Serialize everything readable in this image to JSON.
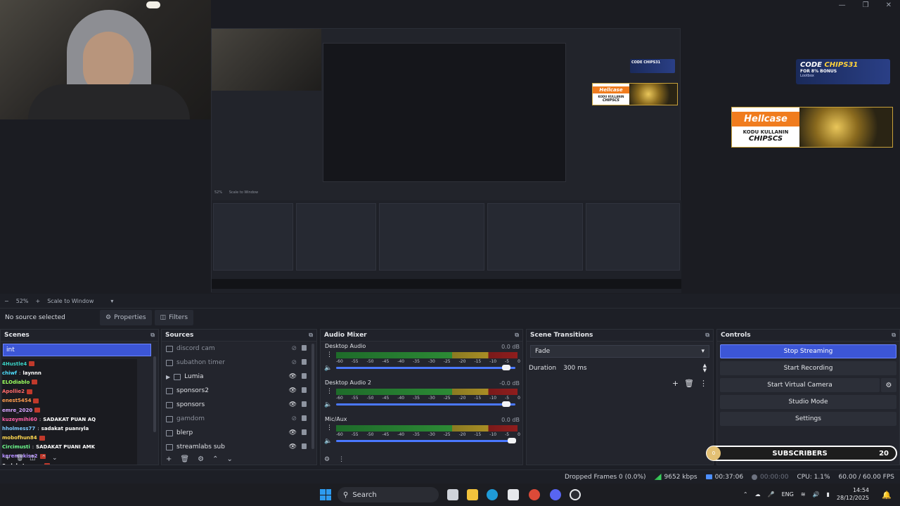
{
  "preview": {
    "nested_scene_label": "Scale to Window",
    "nested_zoom": "52%",
    "mid_badge": {
      "logo": "Hellcase",
      "line1": "KODU KULLANIN",
      "line2": "CHIPSCS"
    },
    "small_promo": "CODE CHIPS31"
  },
  "badge": {
    "logo": "Hellcase",
    "line1": "KODU KULLANIN",
    "line2": "CHIPSCS"
  },
  "promo": {
    "code_prefix": "CODE ",
    "code": "CHIPS31",
    "bonus": "FOR 8% BONUS",
    "brand": "Lootbox"
  },
  "zoom": {
    "percent": "52%",
    "plus": "+",
    "minus": "−",
    "mode": "Scale to Window",
    "caret": "▾"
  },
  "selection": {
    "no_source": "No source selected",
    "properties": "Properties",
    "filters": "Filters"
  },
  "scenes": {
    "title": "Scenes",
    "selected": "int",
    "chat": [
      {
        "nick": "4Hustle4",
        "msg": "",
        "color": "#3ad1c4"
      },
      {
        "nick": "chiwf",
        "msg": "laynnn",
        "color": "#4fe0ff"
      },
      {
        "nick": "ELOdiablo",
        "msg": "",
        "color": "#9cff5f"
      },
      {
        "nick": "Apollie2",
        "msg": "",
        "color": "#ff6b6b"
      },
      {
        "nick": "enest5454",
        "msg": "",
        "color": "#ff9d4f"
      },
      {
        "nick": "emre_2020",
        "msg": "",
        "color": "#d6a4ff"
      },
      {
        "nick": "kuzeymihi60",
        "msg": "SADAKAT PUAN AQ",
        "color": "#ff5fa8"
      },
      {
        "nick": "hholmess77",
        "msg": "sadakat puanıyla",
        "color": "#7ec8ff"
      },
      {
        "nick": "mobofhun84",
        "msg": "",
        "color": "#ffd84f"
      },
      {
        "nick": "Circimusti",
        "msg": "SADAKAT PUANI AMK",
        "color": "#6fff8f"
      },
      {
        "nick": "keremukisa2",
        "msg": "",
        "color": "#b48dff"
      },
      {
        "nick": "Sadakat puanı",
        "msg": "",
        "color": "#ffffff"
      }
    ]
  },
  "sources": {
    "title": "Sources",
    "items": [
      {
        "label": "discord cam",
        "dim": true,
        "icon": "display-capture-icon",
        "visible": false,
        "expand": false
      },
      {
        "label": "subathon timer",
        "dim": true,
        "icon": "browser-source-icon",
        "visible": false,
        "expand": false
      },
      {
        "label": "Lumia",
        "dim": false,
        "icon": "folder-icon",
        "visible": true,
        "expand": true
      },
      {
        "label": "sponsors2",
        "dim": false,
        "icon": "browser-source-icon",
        "visible": true,
        "expand": false
      },
      {
        "label": "sponsors",
        "dim": false,
        "icon": "browser-source-icon",
        "visible": true,
        "expand": false
      },
      {
        "label": "gamdom",
        "dim": true,
        "icon": "browser-source-icon",
        "visible": false,
        "expand": false
      },
      {
        "label": "blerp",
        "dim": false,
        "icon": "browser-source-icon",
        "visible": true,
        "expand": false
      },
      {
        "label": "streamlabs sub",
        "dim": false,
        "icon": "browser-source-icon",
        "visible": true,
        "expand": false
      }
    ]
  },
  "mixer": {
    "title": "Audio Mixer",
    "scale": [
      "-60",
      "-55",
      "-50",
      "-45",
      "-40",
      "-35",
      "-30",
      "-25",
      "-20",
      "-15",
      "-10",
      "-5",
      "0"
    ],
    "channels": [
      {
        "name": "Desktop Audio",
        "db": "0.0 dB",
        "level": 0.95
      },
      {
        "name": "Desktop Audio 2",
        "db": "-0.0 dB",
        "level": 0.95
      },
      {
        "name": "Mic/Aux",
        "db": "0.0 dB",
        "level": 0.98
      }
    ]
  },
  "transitions": {
    "title": "Scene Transitions",
    "selected": "Fade",
    "duration_label": "Duration",
    "duration": "300 ms"
  },
  "controls": {
    "title": "Controls",
    "stop_streaming": "Stop Streaming",
    "start_recording": "Start Recording",
    "start_virtual_camera": "Start Virtual Camera",
    "studio_mode": "Studio Mode",
    "settings": "Settings"
  },
  "subs": {
    "progress": "0",
    "label": "SUBSCRIBERS",
    "count": "20"
  },
  "status": {
    "dropped": "Dropped Frames 0 (0.0%)",
    "bitrate": "9652 kbps",
    "live_time": "00:37:06",
    "rec_time": "00:00:00",
    "cpu": "CPU: 1.1%",
    "fps": "60.00 / 60.00 FPS"
  },
  "taskbar": {
    "search": "Search",
    "lang": "ENG",
    "time": "14:54",
    "date": "28/12/2025"
  },
  "colors": {
    "accent": "#3c56d6",
    "hellcase_orange": "#f07c1e",
    "panel": "#23252d"
  }
}
